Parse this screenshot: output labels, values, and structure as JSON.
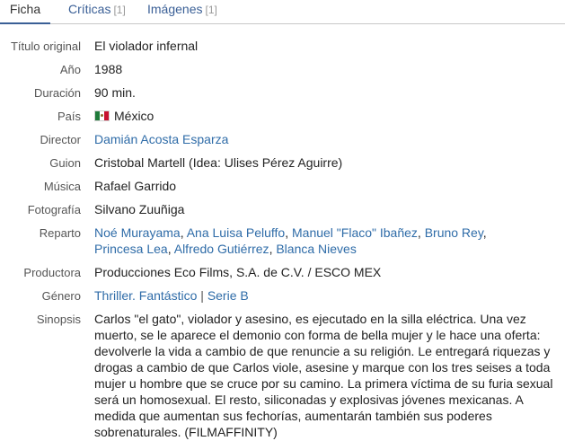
{
  "tabs": [
    {
      "label": "Ficha",
      "count": ""
    },
    {
      "label": "Críticas",
      "count": "[1]"
    },
    {
      "label": "Imágenes",
      "count": "[1]"
    }
  ],
  "fields": {
    "titulo_original": {
      "label": "Título original",
      "value": "El violador infernal"
    },
    "anio": {
      "label": "Año",
      "value": "1988"
    },
    "duracion": {
      "label": "Duración",
      "value": "90 min."
    },
    "pais": {
      "label": "País",
      "value": "México",
      "flag_icon": "mexico-flag-icon"
    },
    "director": {
      "label": "Director",
      "value": "Damián Acosta Esparza"
    },
    "guion": {
      "label": "Guion",
      "value": "Cristobal Martell (Idea: Ulises Pérez Aguirre)"
    },
    "musica": {
      "label": "Música",
      "value": "Rafael Garrido"
    },
    "fotografia": {
      "label": "Fotografía",
      "value": "Silvano Zuuñiga"
    },
    "reparto": {
      "label": "Reparto",
      "actors": [
        "Noé Murayama",
        "Ana Luisa Peluffo",
        "Manuel \"Flaco\" Ibañez",
        "Bruno Rey",
        "Princesa Lea",
        "Alfredo Gutiérrez",
        "Blanca Nieves"
      ]
    },
    "productora": {
      "label": "Productora",
      "value": "Producciones Eco Films, S.A. de C.V. / ESCO MEX"
    },
    "genero": {
      "label": "Género",
      "links": [
        "Thriller.",
        "Fantástico",
        "Serie B"
      ],
      "separator": "|"
    },
    "sinopsis": {
      "label": "Sinopsis",
      "value": "Carlos \"el gato\", violador y asesino, es ejecutado en la silla eléctrica. Una vez muerto, se le aparece el demonio con forma de bella mujer y le hace una oferta: devolverle la vida a cambio de que renuncie a su religión. Le entregará riquezas y drogas a cambio de que Carlos viole, asesine y marque con los tres seises a toda mujer u hombre que se cruce por su camino. La primera víctima de su furia sexual será un homosexual. El resto, siliconadas y explosivas jóvenes mexicanas. A medida que aumentan sus fechorías, aumentarán también sus poderes sobrenaturales. (FILMAFFINITY)"
    }
  },
  "colors": {
    "link": "#2f6ca8",
    "label": "#555555",
    "tab_accent": "#3a5f96"
  }
}
